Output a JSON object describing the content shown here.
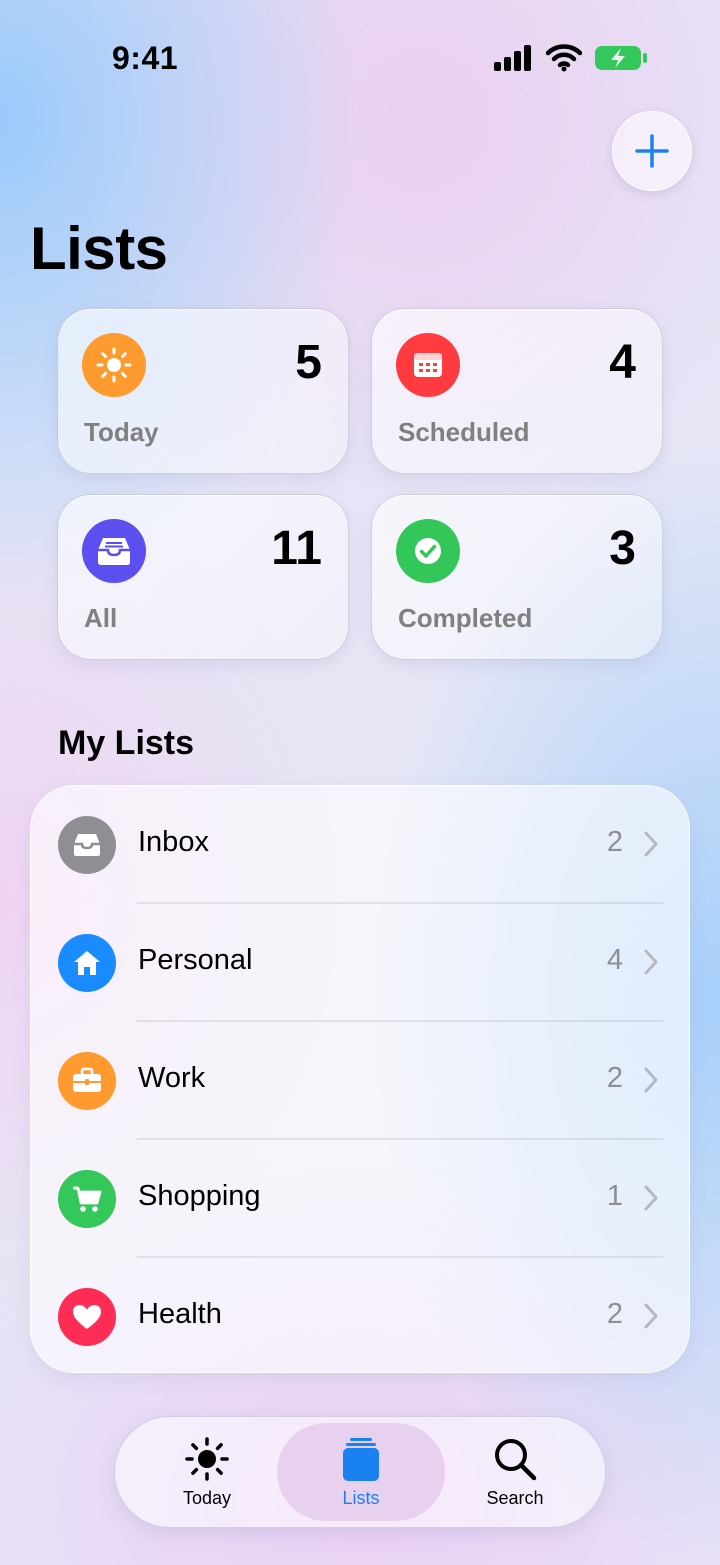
{
  "status_bar": {
    "time": "9:41"
  },
  "header": {
    "title": "Lists",
    "add_icon": "plus-icon"
  },
  "smart_lists": [
    {
      "label": "Today",
      "count": "5",
      "icon": "sun-icon",
      "color": "#ff9a2e"
    },
    {
      "label": "Scheduled",
      "count": "4",
      "icon": "calendar-icon",
      "color": "#ff3b40"
    },
    {
      "label": "All",
      "count": "11",
      "icon": "tray-icon",
      "color": "#5b4ff0"
    },
    {
      "label": "Completed",
      "count": "3",
      "icon": "checkmark-icon",
      "color": "#33c759"
    }
  ],
  "my_lists": {
    "title": "My Lists",
    "items": [
      {
        "label": "Inbox",
        "count": "2",
        "icon": "tray-icon",
        "color": "#8e8e93"
      },
      {
        "label": "Personal",
        "count": "4",
        "icon": "house-icon",
        "color": "#1a8cff"
      },
      {
        "label": "Work",
        "count": "2",
        "icon": "briefcase-icon",
        "color": "#ff9a2e"
      },
      {
        "label": "Shopping",
        "count": "1",
        "icon": "cart-icon",
        "color": "#34c759"
      },
      {
        "label": "Health",
        "count": "2",
        "icon": "heart-icon",
        "color": "#ff2d55"
      }
    ]
  },
  "tab_bar": {
    "tabs": [
      {
        "label": "Today",
        "icon": "sun-icon",
        "active": false
      },
      {
        "label": "Lists",
        "icon": "lists-icon",
        "active": true
      },
      {
        "label": "Search",
        "icon": "magnifier-icon",
        "active": false
      }
    ]
  },
  "colors": {
    "accent": "#1a82f0"
  }
}
